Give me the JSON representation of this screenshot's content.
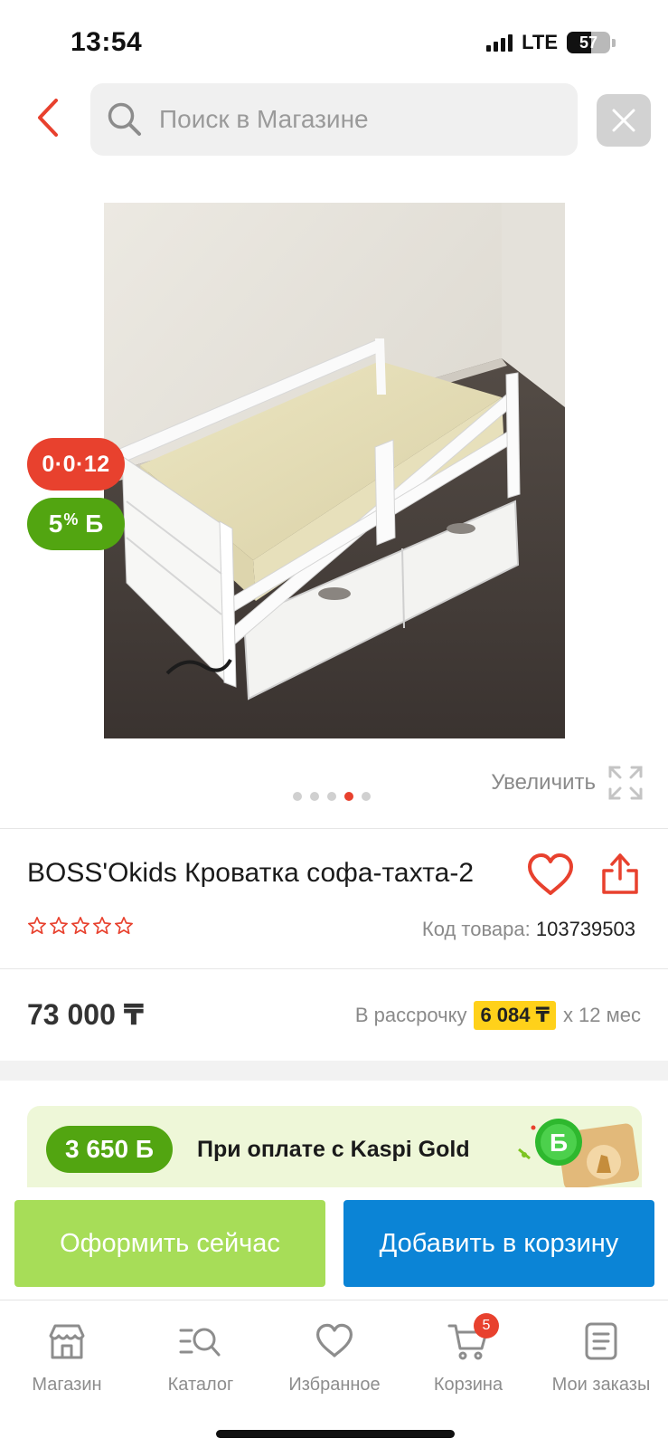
{
  "status_bar": {
    "time": "13:54",
    "network": "LTE",
    "battery_level": "57",
    "icons": [
      "signal-icon",
      "battery-icon"
    ]
  },
  "search": {
    "placeholder": "Поиск в Магазине",
    "value": "",
    "icons": [
      "back-arrow-icon",
      "search-icon",
      "close-icon"
    ]
  },
  "gallery": {
    "badges": {
      "credit": "0·0·12",
      "bonus_percent": "5",
      "bonus_symbol": "%",
      "bonus_currency": "Б"
    },
    "zoom_label": "Увеличить",
    "image_count": 5,
    "active_image": 4
  },
  "product": {
    "title": "BOSS'Okids Кроватка софа-тахта-2",
    "rating_stars": 0,
    "rating_max": 5,
    "sku_label": "Код товара:",
    "sku": "103739503",
    "price": "73 000 ₸",
    "installment_label": "В рассрочку",
    "installment_amount": "6 084 ₸",
    "installment_term": "х 12 мес"
  },
  "gold": {
    "bonus": "3 650 Б",
    "text": "При оплате с Kaspi Gold"
  },
  "actions": {
    "buy_now": "Оформить сейчас",
    "add_to_cart": "Добавить в корзину"
  },
  "tabbar": {
    "items": [
      {
        "label": "Магазин",
        "icon": "shop-icon"
      },
      {
        "label": "Каталог",
        "icon": "catalog-icon"
      },
      {
        "label": "Избранное",
        "icon": "heart-icon"
      },
      {
        "label": "Корзина",
        "icon": "cart-icon"
      },
      {
        "label": "Мои заказы",
        "icon": "orders-icon"
      }
    ],
    "cart_count": "5"
  },
  "colors": {
    "accent_red": "#e8412e",
    "bonus_green": "#52a511",
    "buy_now_green": "#a7dd58",
    "cart_blue": "#0b84d6",
    "installment_yellow": "#ffd11a"
  }
}
